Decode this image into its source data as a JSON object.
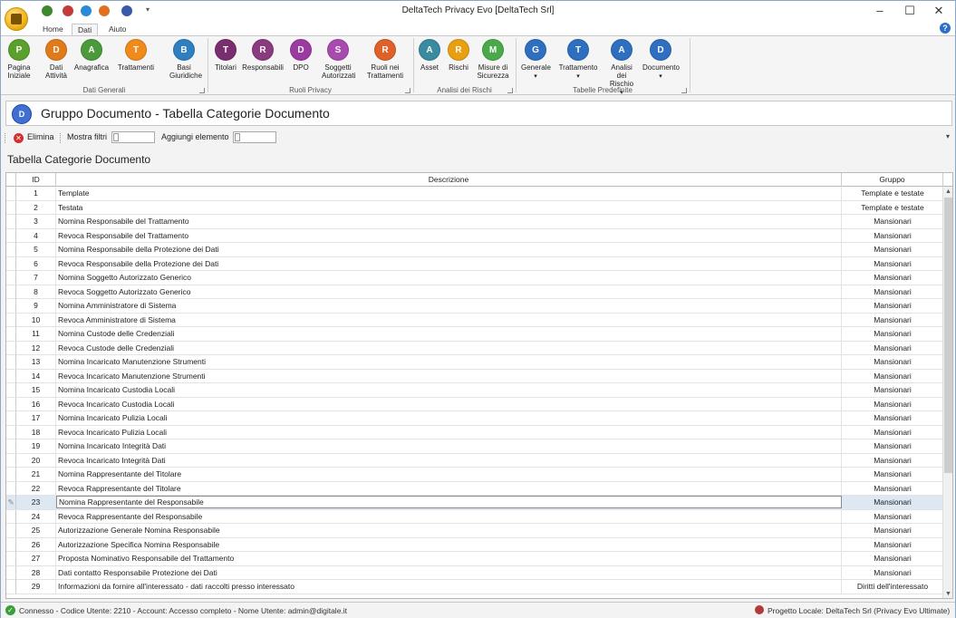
{
  "window": {
    "title": "DeltaTech Privacy Evo [DeltaTech Srl]"
  },
  "tabs": [
    "Home",
    "Dati",
    "Aiuto"
  ],
  "ribbon": {
    "groups": [
      {
        "label": "Dati Generali",
        "buttons": [
          {
            "label": "Pagina\nIniziale",
            "icon": "home-icon",
            "color": "#5aa02c"
          },
          {
            "label": "Dati\nAttività",
            "icon": "building-icon",
            "color": "#e07a1a"
          },
          {
            "label": "Anagrafica",
            "icon": "people-icon",
            "color": "#4a9a3c"
          },
          {
            "label": "Trattamenti",
            "icon": "document-shield-icon",
            "color": "#f08a1a"
          },
          {
            "label": "Basi\nGiuridiche",
            "icon": "scales-icon",
            "color": "#2f7fc0"
          }
        ]
      },
      {
        "label": "Ruoli Privacy",
        "buttons": [
          {
            "label": "Titolari",
            "icon": "titolari-icon",
            "color": "#7a2e6e"
          },
          {
            "label": "Responsabili",
            "icon": "responsabili-icon",
            "color": "#8a3a7e"
          },
          {
            "label": "DPO",
            "icon": "dpo-icon",
            "color": "#9b3aa0"
          },
          {
            "label": "Soggetti\nAutorizzati",
            "icon": "soggetti-icon",
            "color": "#a84ab0"
          },
          {
            "label": "Ruoli nei\nTrattamenti",
            "icon": "roles-mask-icon",
            "color": "#e0602a"
          }
        ]
      },
      {
        "label": "Analisi dei Rischi",
        "buttons": [
          {
            "label": "Asset",
            "icon": "asset-icon",
            "color": "#3a8aa0"
          },
          {
            "label": "Rischi",
            "icon": "warning-icon",
            "color": "#e8a010"
          },
          {
            "label": "Misure di\nSicurezza",
            "icon": "shield-check-icon",
            "color": "#4aaa4a"
          }
        ]
      },
      {
        "label": "Tabelle Predefinite",
        "buttons": [
          {
            "label": "Generale",
            "icon": "table-general-icon",
            "color": "#2f6fc0"
          },
          {
            "label": "Trattamento",
            "icon": "table-treatment-icon",
            "color": "#2f6fc0"
          },
          {
            "label": "Analisi dei\nRischio",
            "icon": "table-risk-icon",
            "color": "#2f6fc0"
          },
          {
            "label": "Documento",
            "icon": "table-document-icon",
            "color": "#2f6fc0"
          }
        ]
      }
    ]
  },
  "header": {
    "title": "Gruppo Documento - Tabella Categorie Documento"
  },
  "toolbar": {
    "delete_label": "Elimina",
    "filters_label": "Mostra filtri",
    "add_label": "Aggiungi elemento"
  },
  "section_title": "Tabella Categorie Documento",
  "table": {
    "columns": [
      "ID",
      "Descrizione",
      "Gruppo"
    ],
    "selected_id": "23",
    "rows": [
      [
        "1",
        "Template",
        "Template e testate"
      ],
      [
        "2",
        "Testata",
        "Template e testate"
      ],
      [
        "3",
        "Nomina Responsabile del Trattamento",
        "Mansionari"
      ],
      [
        "4",
        "Revoca Responsabile del Trattamento",
        "Mansionari"
      ],
      [
        "5",
        "Nomina Responsabile della Protezione dei Dati",
        "Mansionari"
      ],
      [
        "6",
        "Revoca Responsabile della Protezione dei Dati",
        "Mansionari"
      ],
      [
        "7",
        "Nomina Soggetto Autorizzato Generico",
        "Mansionari"
      ],
      [
        "8",
        "Revoca Soggetto Autorizzato Generico",
        "Mansionari"
      ],
      [
        "9",
        "Nomina Amministratore di Sistema",
        "Mansionari"
      ],
      [
        "10",
        "Revoca Amministratore di Sistema",
        "Mansionari"
      ],
      [
        "11",
        "Nomina Custode delle Credenziali",
        "Mansionari"
      ],
      [
        "12",
        "Revoca Custode delle Credenziali",
        "Mansionari"
      ],
      [
        "13",
        "Nomina Incaricato Manutenzione Strumenti",
        "Mansionari"
      ],
      [
        "14",
        "Revoca Incaricato Manutenzione Strumenti",
        "Mansionari"
      ],
      [
        "15",
        "Nomina Incaricato Custodia Locali",
        "Mansionari"
      ],
      [
        "16",
        "Revoca Incaricato Custodia Locali",
        "Mansionari"
      ],
      [
        "17",
        "Nomina Incaricato Pulizia Locali",
        "Mansionari"
      ],
      [
        "18",
        "Revoca Incaricato Pulizia Locali",
        "Mansionari"
      ],
      [
        "19",
        "Nomina Incaricato Integrità Dati",
        "Mansionari"
      ],
      [
        "20",
        "Revoca Incaricato Integrità Dati",
        "Mansionari"
      ],
      [
        "21",
        "Nomina Rappresentante del Titolare",
        "Mansionari"
      ],
      [
        "22",
        "Revoca Rappresentante del Titolare",
        "Mansionari"
      ],
      [
        "23",
        "Nomina Rappresentante del Responsabile",
        "Mansionari"
      ],
      [
        "24",
        "Revoca Rappresentante del Responsabile",
        "Mansionari"
      ],
      [
        "25",
        "Autorizzazione Generale Nomina Responsabile",
        "Mansionari"
      ],
      [
        "26",
        "Autorizzazione Specifica Nomina Responsabile",
        "Mansionari"
      ],
      [
        "27",
        "Proposta Nominativo Responsabile del Trattamento",
        "Mansionari"
      ],
      [
        "28",
        "Dati contatto Responsabile Protezione dei Dati",
        "Mansionari"
      ],
      [
        "29",
        "Informazioni da fornire all'interessato - dati raccolti presso interessato",
        "Diritti dell'interessato"
      ]
    ]
  },
  "statusbar": {
    "left": "Connesso - Codice Utente: 2210 - Account: Accesso completo - Nome Utente: admin@digitale.it",
    "right": "Progetto Locale: DeltaTech Srl (Privacy Evo Ultimate)"
  }
}
